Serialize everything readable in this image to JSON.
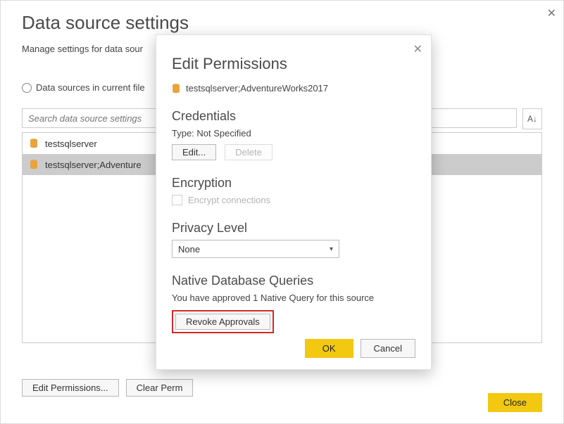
{
  "page": {
    "title": "Data source settings",
    "subtitle": "Manage settings for data sour",
    "radio_label": "Data sources in current file",
    "search_placeholder": "Search data source settings",
    "list_items": [
      "testsqlserver",
      "testsqlserver;Adventure"
    ],
    "edit_permissions_label": "Edit Permissions...",
    "clear_permissions_label": "Clear Perm",
    "close_label": "Close",
    "sort_glyph": "A↓"
  },
  "icon_color": "#e8a33d",
  "modal": {
    "title": "Edit Permissions",
    "datasource": "testsqlserver;AdventureWorks2017",
    "credentials": {
      "heading": "Credentials",
      "type_line": "Type: Not Specified",
      "edit_label": "Edit...",
      "delete_label": "Delete"
    },
    "encryption": {
      "heading": "Encryption",
      "checkbox_label": "Encrypt connections"
    },
    "privacy": {
      "heading": "Privacy Level",
      "value": "None"
    },
    "native": {
      "heading": "Native Database Queries",
      "line": "You have approved 1 Native Query for this source",
      "revoke_label": "Revoke Approvals"
    },
    "ok_label": "OK",
    "cancel_label": "Cancel"
  }
}
